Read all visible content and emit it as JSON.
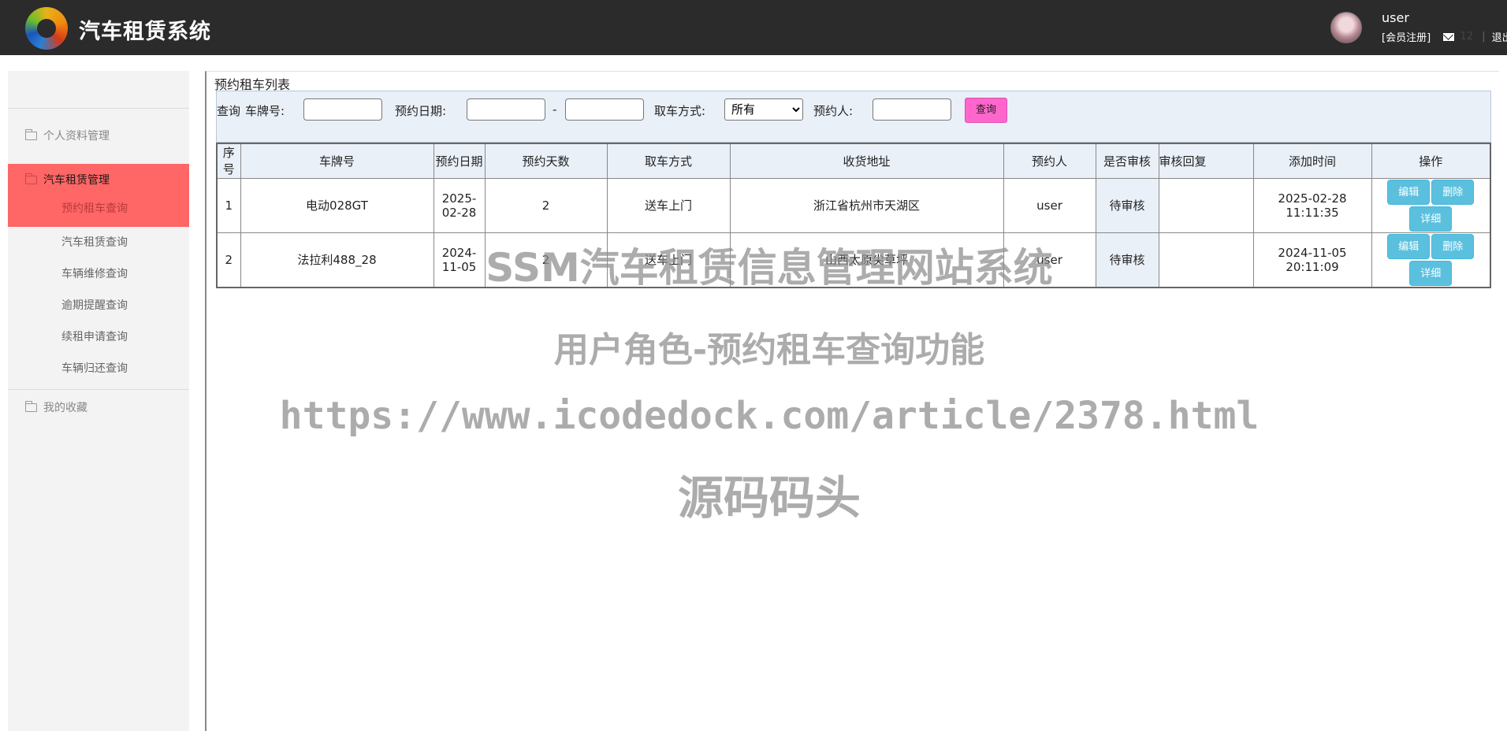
{
  "header": {
    "brand": "汽车租赁系统",
    "username": "user",
    "register_link": "[会员注册]",
    "message_count": "12",
    "separator": "|",
    "logout": "退出"
  },
  "sidebar": {
    "groups": [
      {
        "label": "个人资料管理"
      },
      {
        "label": "汽车租赁管理",
        "items": [
          "预约租车查询",
          "汽车租赁查询",
          "车辆维修查询",
          "逾期提醒查询",
          "续租申请查询",
          "车辆归还查询"
        ]
      },
      {
        "label": "我的收藏"
      }
    ]
  },
  "panel": {
    "title": "预约租车列表",
    "search": {
      "prefix": "查询",
      "plate_label": "车牌号:",
      "date_label": "预约日期:",
      "range_sep": "-",
      "pickup_label": "取车方式:",
      "pickup_selected": "所有",
      "person_label": "预约人:",
      "search_button": "查询"
    },
    "table": {
      "headers": [
        "序号",
        "车牌号",
        "预约日期",
        "预约天数",
        "取车方式",
        "收货地址",
        "预约人",
        "是否审核",
        "审核回复",
        "添加时间",
        "操作"
      ],
      "rows": [
        {
          "no": "1",
          "plate": "电动028GT",
          "date": "2025-02-28",
          "days": "2",
          "pickup": "送车上门",
          "address": "浙江省杭州市天湖区",
          "person": "user",
          "audit": "待审核",
          "reply": "",
          "added": "2025-02-28 11:11:35"
        },
        {
          "no": "2",
          "plate": "法拉利488_28",
          "date": "2024-11-05",
          "days": "2",
          "pickup": "送车上门",
          "address": "山西太原尖草坪",
          "person": "user",
          "audit": "待审核",
          "reply": "",
          "added": "2024-11-05 20:11:09"
        }
      ],
      "actions": {
        "edit": "编辑",
        "delete": "删除",
        "detail": "详细"
      }
    }
  },
  "watermark": {
    "line1": "SSM汽车租赁信息管理网站系统",
    "line2": "用户角色-预约租车查询功能",
    "line3": "https://www.icodedock.com/article/2378.html",
    "line4": "源码码头"
  }
}
